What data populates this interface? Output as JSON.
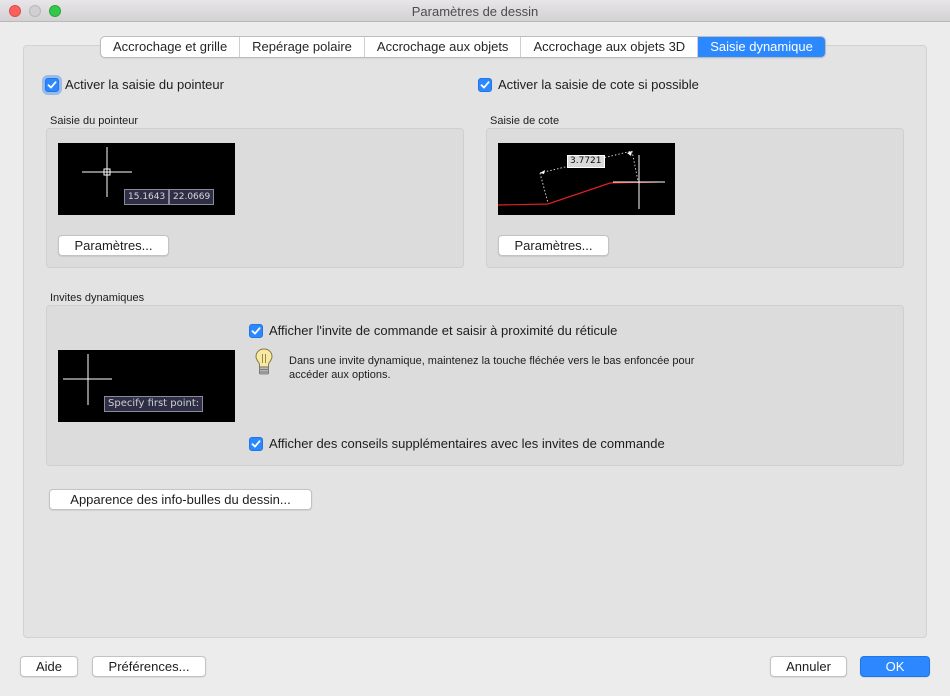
{
  "window": {
    "title": "Paramètres de dessin"
  },
  "tabs": [
    {
      "label": "Accrochage et grille"
    },
    {
      "label": "Repérage polaire"
    },
    {
      "label": "Accrochage aux objets"
    },
    {
      "label": "Accrochage aux objets 3D"
    },
    {
      "label": "Saisie dynamique",
      "active": true
    }
  ],
  "pointer_input": {
    "enable_label": "Activer la saisie du pointeur",
    "checked": true,
    "section_label": "Saisie du pointeur",
    "preview_x": "15.1643",
    "preview_y": "22.0669",
    "settings_button": "Paramètres..."
  },
  "dimension_input": {
    "enable_label": "Activer la saisie de cote si possible",
    "checked": true,
    "section_label": "Saisie de cote",
    "preview_value": "3.7721",
    "settings_button": "Paramètres..."
  },
  "dynamic_prompts": {
    "section_label": "Invites dynamiques",
    "show_prompt_label": "Afficher l'invite de commande et saisir à proximité du réticule",
    "show_prompt_checked": true,
    "hint_line1": "Dans une invite dynamique, maintenez la touche fléchée vers le bas enfoncée pour",
    "hint_line2": "accéder aux options.",
    "preview_prompt": "Specify first point:",
    "extended_tips_label": "Afficher des conseils supplémentaires avec les invites de commande",
    "extended_tips_checked": true
  },
  "tooltip_appearance_button": "Apparence des info-bulles du dessin...",
  "footer": {
    "help": "Aide",
    "preferences": "Préférences...",
    "cancel": "Annuler",
    "ok": "OK"
  },
  "colors": {
    "accent": "#2b88ff",
    "preview_bg": "#000000",
    "dimension_line": "#e02020"
  }
}
